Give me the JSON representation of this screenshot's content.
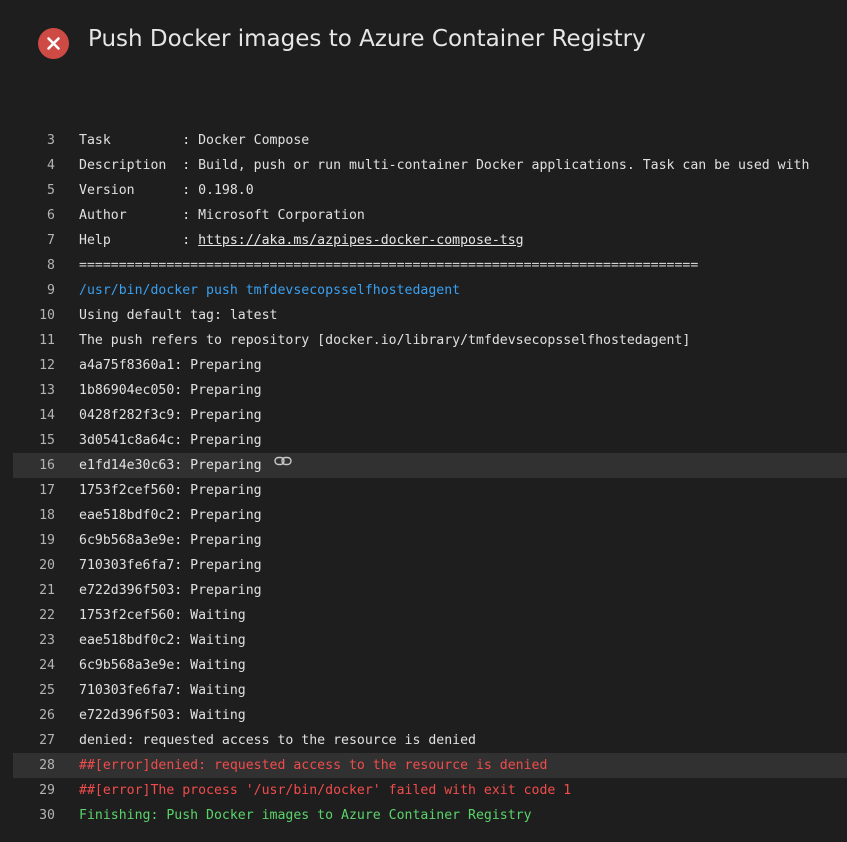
{
  "header": {
    "title": "Push Docker images to Azure Container Registry",
    "status": "error",
    "icon": "error-icon",
    "status_color": "#cd4a45"
  },
  "log": {
    "lines": [
      {
        "n": "3",
        "text": "Task         : Docker Compose",
        "kind": "plain"
      },
      {
        "n": "4",
        "text": "Description  : Build, push or run multi-container Docker applications. Task can be used with",
        "kind": "plain"
      },
      {
        "n": "5",
        "text": "Version      : 0.198.0",
        "kind": "plain"
      },
      {
        "n": "6",
        "text": "Author       : Microsoft Corporation",
        "kind": "plain"
      },
      {
        "n": "7",
        "text": "Help         : ",
        "link": "https://aka.ms/azpipes-docker-compose-tsg",
        "kind": "plain"
      },
      {
        "n": "8",
        "text": "==============================================================================",
        "kind": "sep"
      },
      {
        "n": "9",
        "text": "/usr/bin/docker push tmfdevsecopsselfhostedagent",
        "kind": "cmd"
      },
      {
        "n": "10",
        "text": "Using default tag: latest",
        "kind": "plain"
      },
      {
        "n": "11",
        "text": "The push refers to repository [docker.io/library/tmfdevsecopsselfhostedagent]",
        "kind": "plain"
      },
      {
        "n": "12",
        "text": "a4a75f8360a1: Preparing",
        "kind": "plain"
      },
      {
        "n": "13",
        "text": "1b86904ec050: Preparing",
        "kind": "plain"
      },
      {
        "n": "14",
        "text": "0428f282f3c9: Preparing",
        "kind": "plain"
      },
      {
        "n": "15",
        "text": "3d0541c8a64c: Preparing",
        "kind": "plain"
      },
      {
        "n": "16",
        "text": "e1fd14e30c63: Preparing",
        "kind": "plain",
        "highlight": true,
        "show_link_icon": true
      },
      {
        "n": "17",
        "text": "1753f2cef560: Preparing",
        "kind": "plain"
      },
      {
        "n": "18",
        "text": "eae518bdf0c2: Preparing",
        "kind": "plain"
      },
      {
        "n": "19",
        "text": "6c9b568a3e9e: Preparing",
        "kind": "plain"
      },
      {
        "n": "20",
        "text": "710303fe6fa7: Preparing",
        "kind": "plain"
      },
      {
        "n": "21",
        "text": "e722d396f503: Preparing",
        "kind": "plain"
      },
      {
        "n": "22",
        "text": "1753f2cef560: Waiting",
        "kind": "plain"
      },
      {
        "n": "23",
        "text": "eae518bdf0c2: Waiting",
        "kind": "plain"
      },
      {
        "n": "24",
        "text": "6c9b568a3e9e: Waiting",
        "kind": "plain"
      },
      {
        "n": "25",
        "text": "710303fe6fa7: Waiting",
        "kind": "plain"
      },
      {
        "n": "26",
        "text": "e722d396f503: Waiting",
        "kind": "plain"
      },
      {
        "n": "27",
        "text": "denied: requested access to the resource is denied",
        "kind": "plain"
      },
      {
        "n": "28",
        "text": "##[error]denied: requested access to the resource is denied",
        "kind": "error",
        "highlight": true
      },
      {
        "n": "29",
        "text": "##[error]The process '/usr/bin/docker' failed with exit code 1",
        "kind": "error"
      },
      {
        "n": "30",
        "text": "Finishing: Push Docker images to Azure Container Registry",
        "kind": "success"
      }
    ]
  },
  "colors": {
    "background": "#1e1e1e",
    "command": "#3aa0f0",
    "error": "#f14c4c",
    "success": "#5bd36b",
    "highlight_row": "#313131"
  },
  "icons": {
    "status": "error-icon",
    "line_link": "link-icon"
  }
}
